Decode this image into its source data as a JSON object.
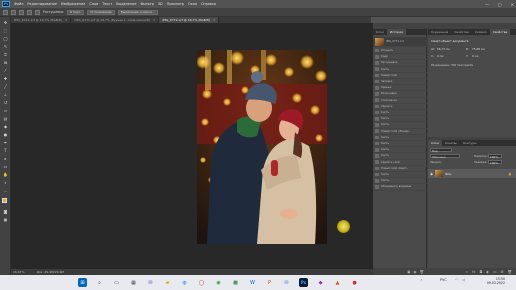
{
  "app": {
    "logo": "Ps",
    "menu": [
      "Файл",
      "Редактирование",
      "Изображение",
      "Слои",
      "Текст",
      "Выделение",
      "Фильтр",
      "3D",
      "Просмотр",
      "Окно",
      "Справка"
    ],
    "window_controls": [
      "—",
      "▢",
      "✕"
    ]
  },
  "options": {
    "size_label": "Растушевка:",
    "size_value": "0 пикс.",
    "antialias": "Сглаживание",
    "select_mask": "Выделение и маска..."
  },
  "tabs": [
    {
      "label": "DSC_0211.xcf @ 16,7% (RGB/8)",
      "active": false
    },
    {
      "label": "DSC_0171.xcf @ 16,7% (Ручная 1, Слой-маска/8)",
      "active": false
    },
    {
      "label": "IMG_9771.xcf @ 16,7% (RGB/8)",
      "active": true
    }
  ],
  "status": {
    "zoom": "16,67%",
    "doc": "Док: 29,9M/29,9M"
  },
  "history_panel": {
    "tabs": [
      "Слои",
      "История"
    ],
    "active_tab": "История",
    "snapshot": "IMG_9771.cr2",
    "items": [
      "Открыть",
      "Кадр",
      "Растушевка",
      "Кисть",
      "Новый слой",
      "Заливка",
      "Кривые",
      "Вход кадра",
      "Слой-маска",
      "Удалить",
      "Кисть",
      "Кисть",
      "Кисть",
      "Новый слой «Линии»",
      "Кисть",
      "Кисть",
      "Кисть",
      "Кисть",
      "Удалить слой",
      "Новый слой «Цвет»",
      "Кисть",
      "Кисть",
      "Объединить видимые"
    ]
  },
  "properties_panel": {
    "tabs": [
      "Коррекция",
      "Свойства",
      "Символ",
      "Свойства"
    ],
    "title": "Смарт-объект документа",
    "w_label": "Ш:",
    "w_value": "56,73 см",
    "h_label": "В:",
    "h_value": "75,68 см",
    "x_label": "X:",
    "x_value": "0 см",
    "y_label": "Y:",
    "y_value": "0 см",
    "info": "Разрешение: 300 пикс/дюйм"
  },
  "layers_panel": {
    "tabs": [
      "Слои",
      "Каналы",
      "Контуры"
    ],
    "kind": "Вид",
    "mode": "Обычные",
    "opacity_label": "Непрозр.:",
    "opacity": "100%",
    "lock_label": "Закреп.:",
    "fill_label": "Заливка:",
    "fill": "100%",
    "layers": [
      {
        "name": "Фон",
        "visible": true
      }
    ]
  },
  "taskbar": {
    "lang": "РУС",
    "time": "15:50",
    "date": "09.03.2022"
  }
}
